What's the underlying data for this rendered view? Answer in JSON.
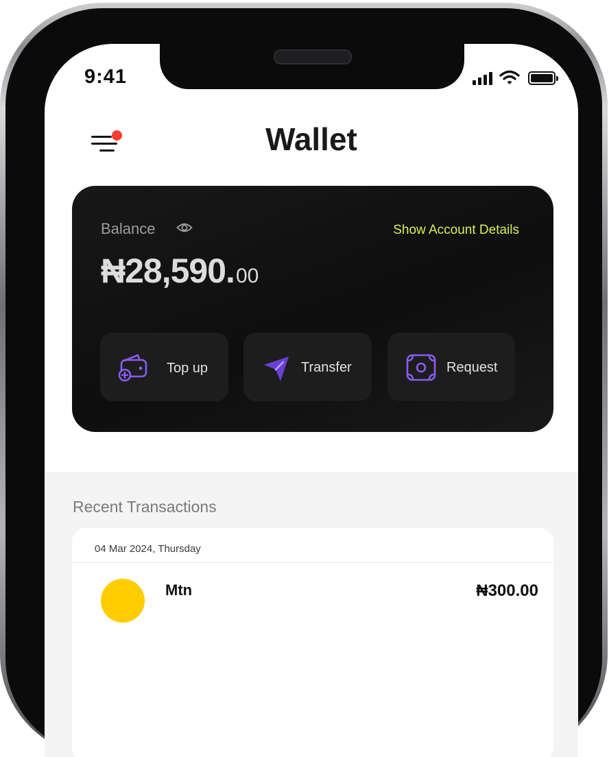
{
  "status_bar": {
    "time": "9:41"
  },
  "header": {
    "title": "Wallet"
  },
  "balance_card": {
    "label": "Balance",
    "show_details_link": "Show Account Details",
    "amount_main": "₦28,590.",
    "amount_cents": "00"
  },
  "actions": [
    {
      "label": "Top up",
      "icon": "wallet-add-icon"
    },
    {
      "label": "Transfer",
      "icon": "send-icon"
    },
    {
      "label": "Request",
      "icon": "cash-request-icon"
    }
  ],
  "transactions": {
    "title": "Recent Transactions",
    "date_header": "04 Mar 2024, Thursday",
    "items": [
      {
        "name": "Mtn",
        "amount": "₦300.00",
        "avatar_color": "#ffcc00"
      }
    ]
  },
  "colors": {
    "accent_lime": "#d6f05a",
    "accent_purple": "#7b4fe0",
    "notification_dot": "#ff3b30",
    "card_bg": "#111111"
  }
}
